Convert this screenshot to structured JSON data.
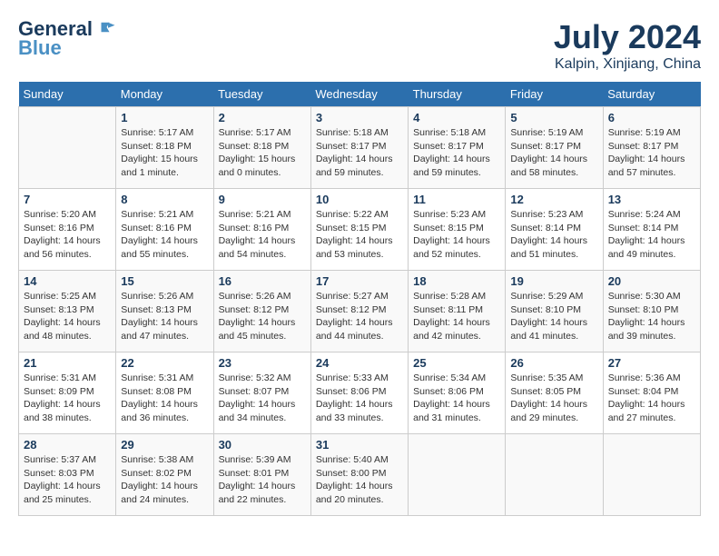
{
  "header": {
    "logo_line1": "General",
    "logo_line2": "Blue",
    "month_year": "July 2024",
    "location": "Kalpin, Xinjiang, China"
  },
  "weekdays": [
    "Sunday",
    "Monday",
    "Tuesday",
    "Wednesday",
    "Thursday",
    "Friday",
    "Saturday"
  ],
  "weeks": [
    [
      {
        "day": "",
        "info": ""
      },
      {
        "day": "1",
        "info": "Sunrise: 5:17 AM\nSunset: 8:18 PM\nDaylight: 15 hours\nand 1 minute."
      },
      {
        "day": "2",
        "info": "Sunrise: 5:17 AM\nSunset: 8:18 PM\nDaylight: 15 hours\nand 0 minutes."
      },
      {
        "day": "3",
        "info": "Sunrise: 5:18 AM\nSunset: 8:17 PM\nDaylight: 14 hours\nand 59 minutes."
      },
      {
        "day": "4",
        "info": "Sunrise: 5:18 AM\nSunset: 8:17 PM\nDaylight: 14 hours\nand 59 minutes."
      },
      {
        "day": "5",
        "info": "Sunrise: 5:19 AM\nSunset: 8:17 PM\nDaylight: 14 hours\nand 58 minutes."
      },
      {
        "day": "6",
        "info": "Sunrise: 5:19 AM\nSunset: 8:17 PM\nDaylight: 14 hours\nand 57 minutes."
      }
    ],
    [
      {
        "day": "7",
        "info": "Sunrise: 5:20 AM\nSunset: 8:16 PM\nDaylight: 14 hours\nand 56 minutes."
      },
      {
        "day": "8",
        "info": "Sunrise: 5:21 AM\nSunset: 8:16 PM\nDaylight: 14 hours\nand 55 minutes."
      },
      {
        "day": "9",
        "info": "Sunrise: 5:21 AM\nSunset: 8:16 PM\nDaylight: 14 hours\nand 54 minutes."
      },
      {
        "day": "10",
        "info": "Sunrise: 5:22 AM\nSunset: 8:15 PM\nDaylight: 14 hours\nand 53 minutes."
      },
      {
        "day": "11",
        "info": "Sunrise: 5:23 AM\nSunset: 8:15 PM\nDaylight: 14 hours\nand 52 minutes."
      },
      {
        "day": "12",
        "info": "Sunrise: 5:23 AM\nSunset: 8:14 PM\nDaylight: 14 hours\nand 51 minutes."
      },
      {
        "day": "13",
        "info": "Sunrise: 5:24 AM\nSunset: 8:14 PM\nDaylight: 14 hours\nand 49 minutes."
      }
    ],
    [
      {
        "day": "14",
        "info": "Sunrise: 5:25 AM\nSunset: 8:13 PM\nDaylight: 14 hours\nand 48 minutes."
      },
      {
        "day": "15",
        "info": "Sunrise: 5:26 AM\nSunset: 8:13 PM\nDaylight: 14 hours\nand 47 minutes."
      },
      {
        "day": "16",
        "info": "Sunrise: 5:26 AM\nSunset: 8:12 PM\nDaylight: 14 hours\nand 45 minutes."
      },
      {
        "day": "17",
        "info": "Sunrise: 5:27 AM\nSunset: 8:12 PM\nDaylight: 14 hours\nand 44 minutes."
      },
      {
        "day": "18",
        "info": "Sunrise: 5:28 AM\nSunset: 8:11 PM\nDaylight: 14 hours\nand 42 minutes."
      },
      {
        "day": "19",
        "info": "Sunrise: 5:29 AM\nSunset: 8:10 PM\nDaylight: 14 hours\nand 41 minutes."
      },
      {
        "day": "20",
        "info": "Sunrise: 5:30 AM\nSunset: 8:10 PM\nDaylight: 14 hours\nand 39 minutes."
      }
    ],
    [
      {
        "day": "21",
        "info": "Sunrise: 5:31 AM\nSunset: 8:09 PM\nDaylight: 14 hours\nand 38 minutes."
      },
      {
        "day": "22",
        "info": "Sunrise: 5:31 AM\nSunset: 8:08 PM\nDaylight: 14 hours\nand 36 minutes."
      },
      {
        "day": "23",
        "info": "Sunrise: 5:32 AM\nSunset: 8:07 PM\nDaylight: 14 hours\nand 34 minutes."
      },
      {
        "day": "24",
        "info": "Sunrise: 5:33 AM\nSunset: 8:06 PM\nDaylight: 14 hours\nand 33 minutes."
      },
      {
        "day": "25",
        "info": "Sunrise: 5:34 AM\nSunset: 8:06 PM\nDaylight: 14 hours\nand 31 minutes."
      },
      {
        "day": "26",
        "info": "Sunrise: 5:35 AM\nSunset: 8:05 PM\nDaylight: 14 hours\nand 29 minutes."
      },
      {
        "day": "27",
        "info": "Sunrise: 5:36 AM\nSunset: 8:04 PM\nDaylight: 14 hours\nand 27 minutes."
      }
    ],
    [
      {
        "day": "28",
        "info": "Sunrise: 5:37 AM\nSunset: 8:03 PM\nDaylight: 14 hours\nand 25 minutes."
      },
      {
        "day": "29",
        "info": "Sunrise: 5:38 AM\nSunset: 8:02 PM\nDaylight: 14 hours\nand 24 minutes."
      },
      {
        "day": "30",
        "info": "Sunrise: 5:39 AM\nSunset: 8:01 PM\nDaylight: 14 hours\nand 22 minutes."
      },
      {
        "day": "31",
        "info": "Sunrise: 5:40 AM\nSunset: 8:00 PM\nDaylight: 14 hours\nand 20 minutes."
      },
      {
        "day": "",
        "info": ""
      },
      {
        "day": "",
        "info": ""
      },
      {
        "day": "",
        "info": ""
      }
    ]
  ]
}
